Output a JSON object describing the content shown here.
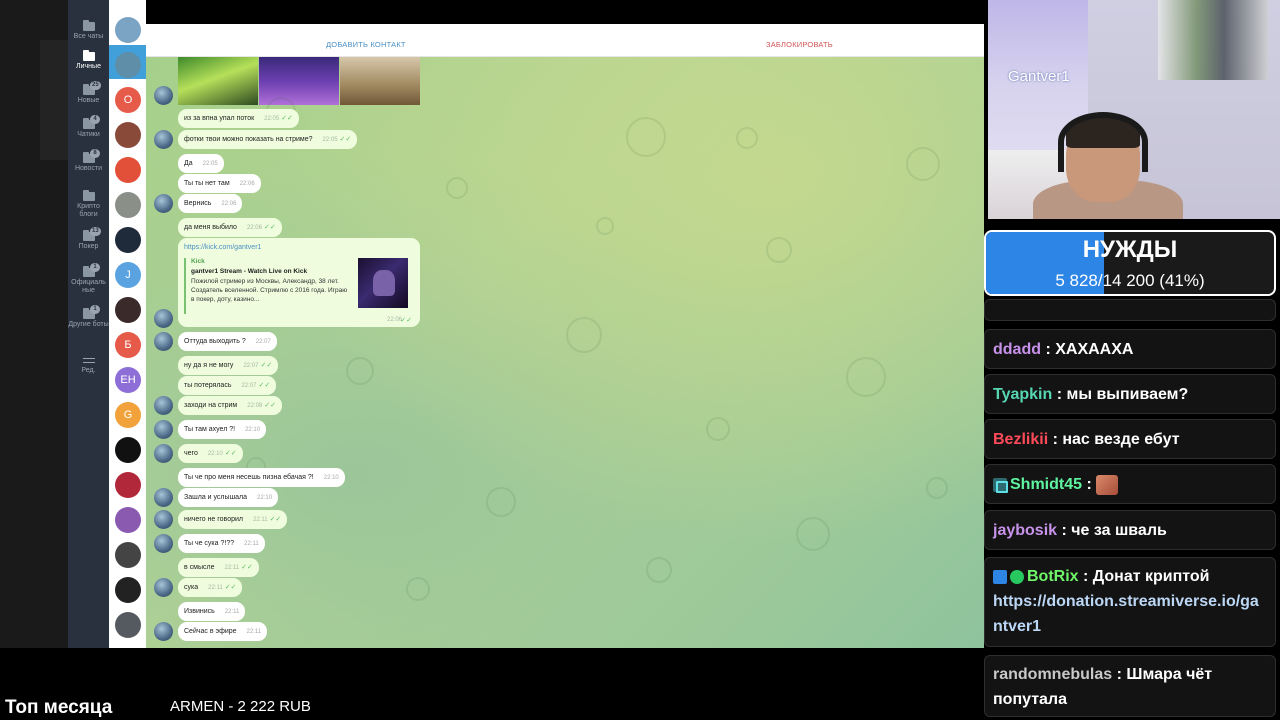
{
  "folders": [
    {
      "label": "Все чаты",
      "badge": ""
    },
    {
      "label": "Личные",
      "badge": ""
    },
    {
      "label": "Новые",
      "badge": "25"
    },
    {
      "label": "Чатики",
      "badge": "4"
    },
    {
      "label": "Новости",
      "badge": "8"
    },
    {
      "label": "Крипто блоги",
      "badge": ""
    },
    {
      "label": "Покер",
      "badge": "13"
    },
    {
      "label": "Официаль ные",
      "badge": "1"
    },
    {
      "label": "Другие боты",
      "badge": "1"
    },
    {
      "label": "Ред.",
      "badge": ""
    }
  ],
  "avatars": [
    {
      "letter": "",
      "color": "#7aa3c4"
    },
    {
      "letter": "",
      "color": "#5f8fa8"
    },
    {
      "letter": "O",
      "color": "#e65a4a"
    },
    {
      "letter": "",
      "color": "#8a4a3a"
    },
    {
      "letter": "",
      "color": "#e2503a"
    },
    {
      "letter": "",
      "color": "#8a8f88"
    },
    {
      "letter": "",
      "color": "#1f2a3a"
    },
    {
      "letter": "J",
      "color": "#5aa3e0"
    },
    {
      "letter": "",
      "color": "#3a2a2a"
    },
    {
      "letter": "Б",
      "color": "#e65a4a"
    },
    {
      "letter": "ЕН",
      "color": "#8c6ed6"
    },
    {
      "letter": "G",
      "color": "#f2a23a"
    },
    {
      "letter": "",
      "color": "#111111"
    },
    {
      "letter": "",
      "color": "#b0283a"
    },
    {
      "letter": "",
      "color": "#8a5ab0"
    },
    {
      "letter": "",
      "color": "#444444"
    },
    {
      "letter": "",
      "color": "#222222"
    },
    {
      "letter": "",
      "color": "#555a60"
    }
  ],
  "header": {
    "add_contact": "ДОБАВИТЬ КОНТАКТ",
    "block": "ЗАБЛОКИРОВАТЬ"
  },
  "messages": [
    {
      "text": "из за впна упал поток",
      "time": "22:05",
      "out": true,
      "avatar": false
    },
    {
      "text": "фотки твои можно показать на стриме?",
      "time": "22:05",
      "out": true,
      "avatar": true
    },
    {
      "text": "Да",
      "time": "22:05",
      "out": false,
      "avatar": false
    },
    {
      "text": "Ты ты нет там",
      "time": "22:06",
      "out": false,
      "avatar": false
    },
    {
      "text": "Вернись",
      "time": "22:06",
      "out": false,
      "avatar": true
    },
    {
      "text": "да меня выбило",
      "time": "22:06",
      "out": true,
      "avatar": false
    },
    {
      "text": "Оттуда выходить ?",
      "time": "22:07",
      "out": false,
      "avatar": true
    },
    {
      "text": "ну да я не могу",
      "time": "22:07",
      "out": true,
      "avatar": false
    },
    {
      "text": "ты потерялась",
      "time": "22:07",
      "out": true,
      "avatar": false
    },
    {
      "text": "заходи на стрим",
      "time": "22:08",
      "out": true,
      "avatar": true
    },
    {
      "text": "Ты там ахуел ?!",
      "time": "22:10",
      "out": false,
      "avatar": true
    },
    {
      "text": "чего",
      "time": "22:10",
      "out": true,
      "avatar": true
    },
    {
      "text": "Ты че про меня несешь пизна ебачая ?!",
      "time": "22:10",
      "out": false,
      "avatar": false
    },
    {
      "text": "Зашла и услышала",
      "time": "22:10",
      "out": false,
      "avatar": true
    },
    {
      "text": "ничего не говорил",
      "time": "22:11",
      "out": true,
      "avatar": true
    },
    {
      "text": "Ты че сука ?!??",
      "time": "22:11",
      "out": false,
      "avatar": true
    },
    {
      "text": "в смысле",
      "time": "22:11",
      "out": true,
      "avatar": false
    },
    {
      "text": "сука",
      "time": "22:11",
      "out": true,
      "avatar": true
    },
    {
      "text": "Извинись",
      "time": "22:11",
      "out": false,
      "avatar": false
    },
    {
      "text": "Сейчас в эфире",
      "time": "22:11",
      "out": false,
      "avatar": true
    }
  ],
  "link_message": {
    "url": "https://kick.com/gantver1",
    "site": "Kick",
    "title": "gantver1 Stream - Watch Live on Kick",
    "description": "Пожилой стример из Москвы, Александр, 38 лет. Создатель вселенной. Стримлю с 2016 года. Играю в покер, доту, казино...",
    "time": "22:06"
  },
  "webcam": {
    "name": "Gantver1"
  },
  "goal": {
    "title": "НУЖДЫ",
    "progress": "5 828/14 200 (41%)",
    "fraction": 0.41,
    "fill_color": "#2d86e6"
  },
  "chat": [
    {
      "user": "ddadd",
      "color": "#c792ea",
      "text": "ХАХААХА",
      "badge": ""
    },
    {
      "user": "Tyapkin",
      "color": "#56d6b2",
      "text": "мы выпиваем?",
      "badge": ""
    },
    {
      "user": "Bezlikii",
      "color": "#ff4a5a",
      "text": "нас везде ебут",
      "badge": ""
    },
    {
      "user": "Shmidt45",
      "color": "#5ff5a0",
      "text": "",
      "badge": "shmidt"
    },
    {
      "user": "jaybosik",
      "color": "#c792ea",
      "text": "че за шваль",
      "badge": ""
    },
    {
      "user": "BotRix",
      "color": "#6ff56a",
      "text": "Донат криптой",
      "link": "https://donation.streamiverse.io/gantver1",
      "badge": "bot"
    },
    {
      "user": "randomnebulas",
      "color": "#c9c9c9",
      "text": "Шмара чёт попутала",
      "badge": ""
    }
  ],
  "bottom": {
    "top_month": "Топ месяца",
    "top_donor": "ARMEN - 2 222 RUB"
  }
}
